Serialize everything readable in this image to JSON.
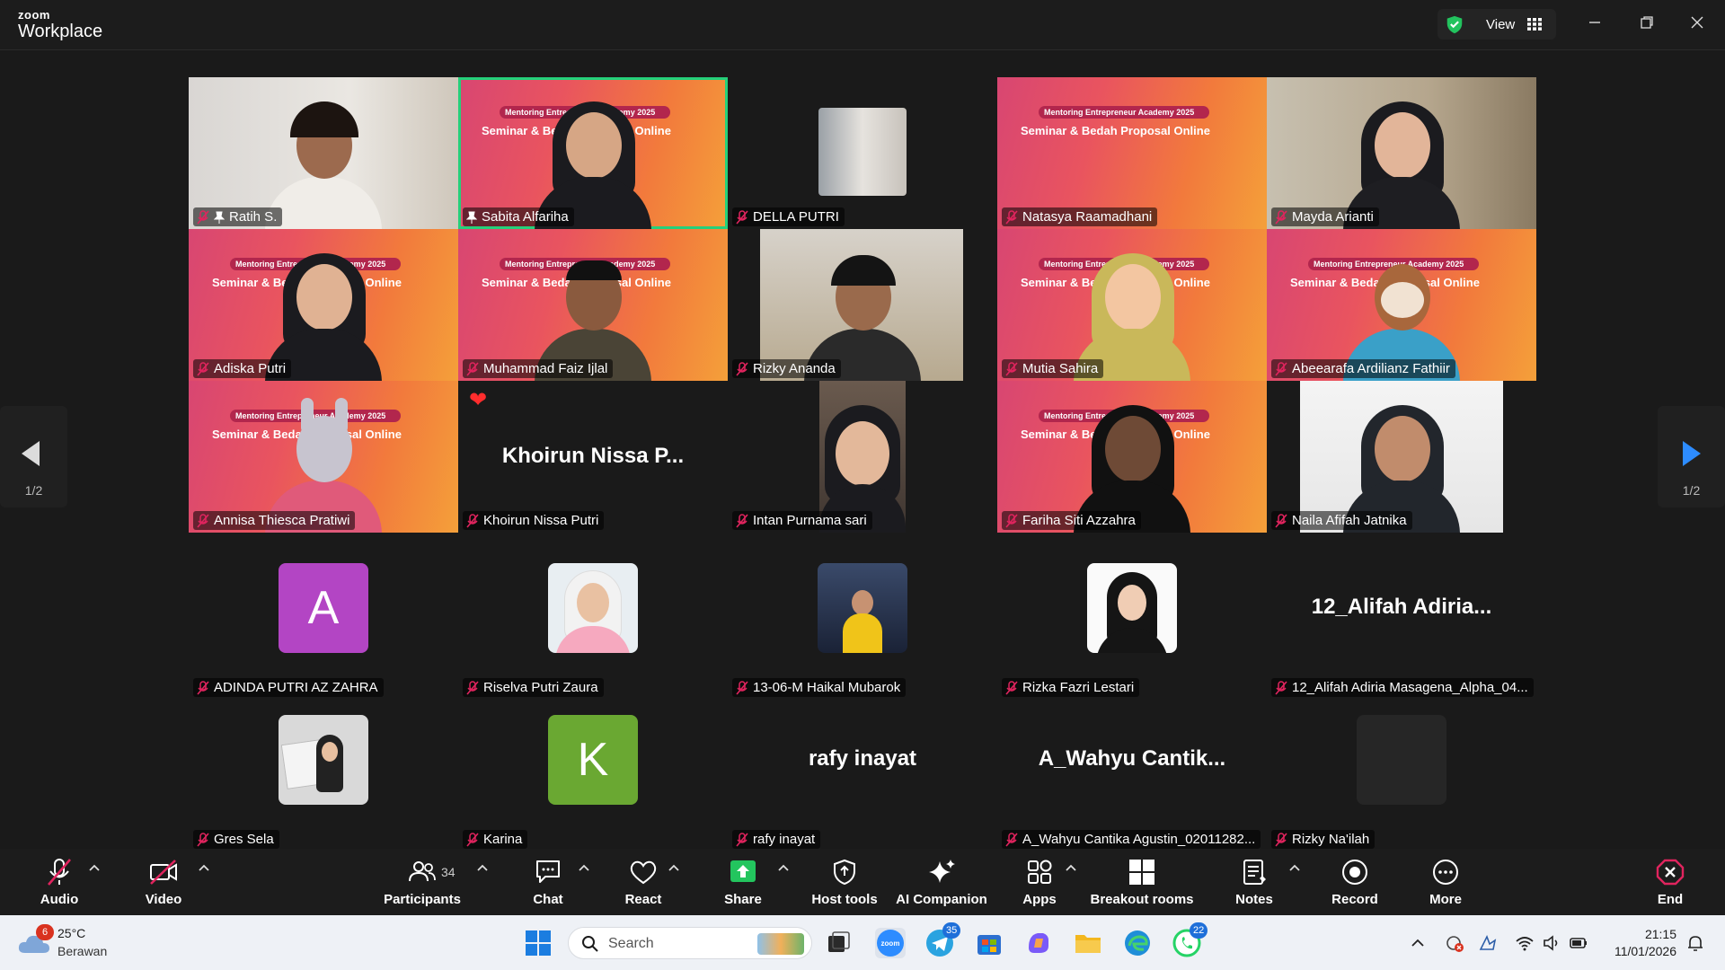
{
  "app": {
    "brand_small": "zoom",
    "brand_name": "Workplace",
    "view_label": "View"
  },
  "colors": {
    "active_speaker": "#25d07a",
    "banner_start": "#d84672",
    "banner_end": "#f4a03a",
    "mic_muted": "#e0245e"
  },
  "banner": {
    "line1": "Mentoring Entrepreneur Academy 2025",
    "line2": "Seminar & Bedah Proposal Online"
  },
  "gallery": {
    "page_left": "1/2",
    "page_right": "1/2",
    "tiles": [
      {
        "name": "Ratih S.",
        "pinned": true
      },
      {
        "name": "Sabita Alfariha",
        "pinned": true,
        "active": true
      },
      {
        "name": "DELLA PUTRI"
      },
      {
        "name": "Natasya Raamadhani"
      },
      {
        "name": "Mayda Arianti"
      },
      {
        "name": "Adiska Putri"
      },
      {
        "name": "Muhammad Faiz Ijlal"
      },
      {
        "name": "Rizky Ananda"
      },
      {
        "name": "Mutia Sahira"
      },
      {
        "name": "Abeearafa Ardilianz Fathiir"
      },
      {
        "name": "Annisa Thiesca Pratiwi"
      },
      {
        "name": "Khoirun Nissa Putri",
        "display": "Khoirun  Nissa  P..."
      },
      {
        "name": "Intan Purnama sari"
      },
      {
        "name": "Fariha Siti Azzahra"
      },
      {
        "name": "Naila Afifah Jatnika"
      },
      {
        "name": "ADINDA PUTRI AZ ZAHRA",
        "letter": "A"
      },
      {
        "name": "Riselva Putri Zaura"
      },
      {
        "name": "13-06-M Haikal Mubarok"
      },
      {
        "name": "Rizka Fazri Lestari"
      },
      {
        "name": "12_Alifah Adiria Masagena_Alpha_04...",
        "display": "12_Alifah  Adiria..."
      },
      {
        "name": "Gres Sela"
      },
      {
        "name": "Karina",
        "letter": "K"
      },
      {
        "name": "rafy inayat",
        "display": "rafy inayat"
      },
      {
        "name": "A_Wahyu Cantika Agustin_02011282...",
        "display": "A_Wahyu  Cantik..."
      },
      {
        "name": "Rizky Na'ilah"
      }
    ]
  },
  "toolbar": {
    "audio": "Audio",
    "video": "Video",
    "participants": "Participants",
    "participants_count": "34",
    "chat": "Chat",
    "react": "React",
    "share": "Share",
    "host_tools": "Host tools",
    "ai_companion": "AI Companion",
    "apps": "Apps",
    "breakout_rooms": "Breakout rooms",
    "notes": "Notes",
    "record": "Record",
    "more": "More",
    "end": "End"
  },
  "taskbar": {
    "weather_badge": "6",
    "temperature": "25°C",
    "condition": "Berawan",
    "search_placeholder": "Search",
    "telegram_badge": "35",
    "whatsapp_badge": "22",
    "time": "21:15",
    "date": "11/01/2026"
  }
}
